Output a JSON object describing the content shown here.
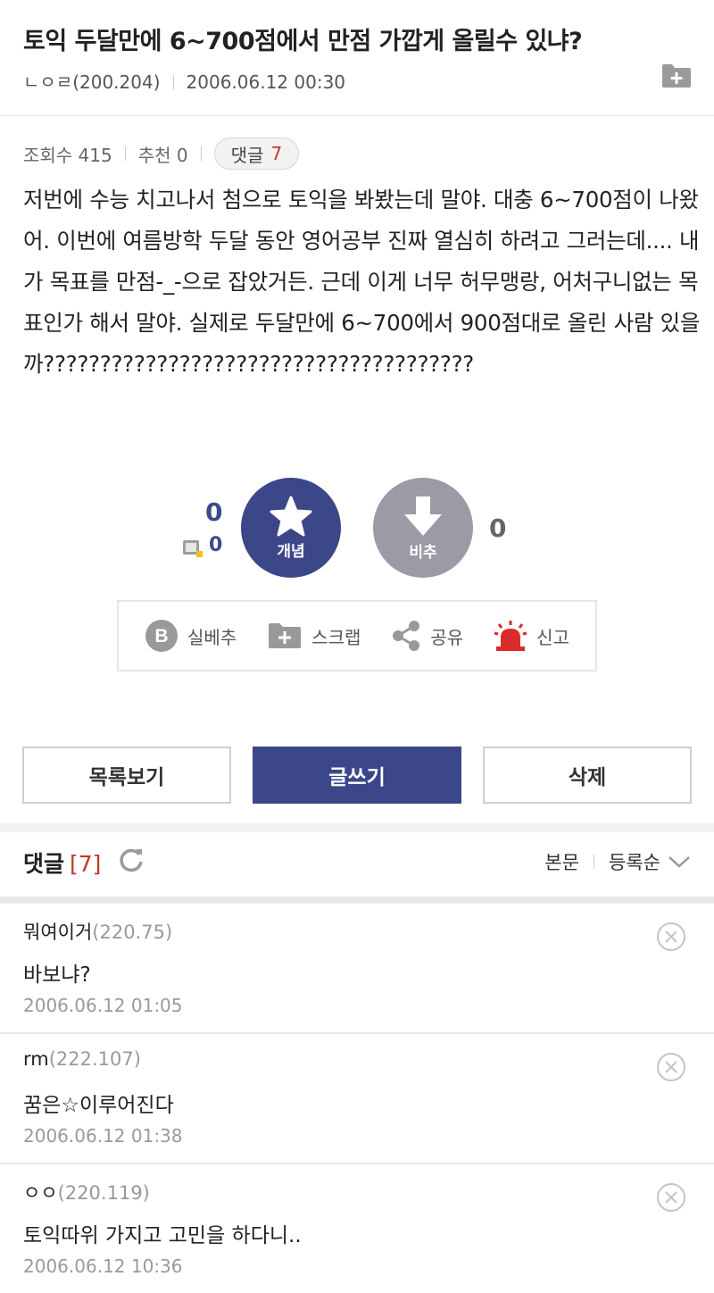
{
  "post": {
    "title": "토익 두달만에 6~700점에서 만점 가깝게 올릴수 있냐?",
    "author": "ㄴㅇㄹ(200.204)",
    "datetime": "2006.06.12 00:30",
    "views_label": "조회수 415",
    "recommend_label": "추천 0",
    "comment_label": "댓글",
    "comment_count": "7",
    "body": "저번에 수능 치고나서 첨으로 토익을 봐봤는데 말야. 대충 6~700점이 나왔어. 이번에 여름방학 두달 동안 영어공부 진짜 열심히 하려고 그러는데.... 내가 목표를 만점-_-으로 잡았거든. 근데 이게 너무 허무맹랑, 어처구니없는 목표인가 해서 말야. 실제로 두달만에 6~700에서 900점대로 올린 사람 있을까??????????????????????????????????????"
  },
  "vote": {
    "up_count": "0",
    "up_sub_count": "0",
    "up_label": "개념",
    "down_label": "비추",
    "down_count": "0"
  },
  "actions": {
    "best": "실베추",
    "scrap": "스크랩",
    "share": "공유",
    "report": "신고"
  },
  "buttons": {
    "list": "목록보기",
    "write": "글쓰기",
    "delete": "삭제"
  },
  "comments_section": {
    "title": "댓글",
    "count": "[7]",
    "sort_body": "본문",
    "sort_order": "등록순"
  },
  "comments": [
    {
      "name": "뭐여이거",
      "ip": "(220.75)",
      "text": "바보냐?",
      "date": "2006.06.12 01:05"
    },
    {
      "name": "rm",
      "ip": "(222.107)",
      "text": "꿈은☆이루어진다",
      "date": "2006.06.12 01:38"
    },
    {
      "name": "ㅇㅇ",
      "ip": "(220.119)",
      "text": "토익따위 가지고 고민을 하다니..",
      "date": "2006.06.12 10:36"
    }
  ],
  "colors": {
    "accent": "#3c4789",
    "downvote": "#9b9ba5",
    "count_red": "#c0392b"
  }
}
